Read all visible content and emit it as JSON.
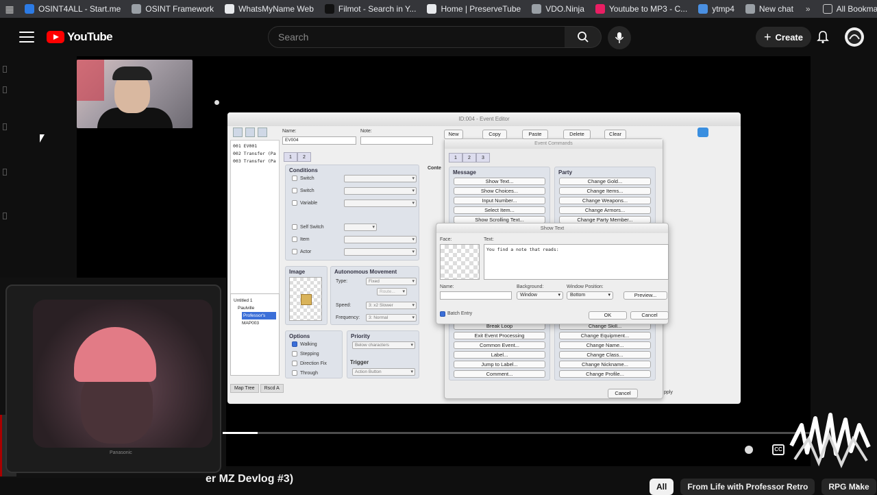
{
  "bookmarks": [
    {
      "label": "OSINT4ALL - Start.me",
      "color": "#2c7be5"
    },
    {
      "label": "OSINT Framework",
      "color": "#9aa0a6"
    },
    {
      "label": "WhatsMyName Web",
      "color": "#e8eaed"
    },
    {
      "label": "Filmot - Search in Y...",
      "color": "#111111"
    },
    {
      "label": "Home | PreserveTube",
      "color": "#e8eaed"
    },
    {
      "label": "VDO.Ninja",
      "color": "#9aa0a6"
    },
    {
      "label": "Youtube to MP3 - C...",
      "color": "#e91e63"
    },
    {
      "label": "ytmp4",
      "color": "#4a90e2"
    },
    {
      "label": "New chat",
      "color": "#9aa0a6"
    }
  ],
  "bookmarks_more": "»",
  "bookmarks_all": "All Bookmarks",
  "header": {
    "logo": "YouTube",
    "search_placeholder": "Search",
    "create_label": "Create"
  },
  "editor": {
    "title": "ID:004 - Event Editor",
    "name_label": "Name:",
    "name_value": "EV004",
    "note_label": "Note:",
    "top_buttons": [
      "New",
      "Copy",
      "Paste",
      "Delete",
      "Clear"
    ],
    "event_list": [
      "001 EV001",
      "002 Transfer (Pa",
      "003 Transfer (Pa"
    ],
    "map_tree": [
      "Untitled 1",
      "Paulville",
      "Professor's",
      "MAP003"
    ],
    "map_tabs": [
      "Map Tree",
      "Rscd A"
    ],
    "pages": [
      "1",
      "2"
    ],
    "conditions_title": "Conditions",
    "conditions": [
      "Switch",
      "Switch",
      "Variable",
      "Self Switch",
      "Item",
      "Actor"
    ],
    "contents_label": "Conte",
    "image_title": "Image",
    "auto_title": "Autonomous Movement",
    "type_label": "Type:",
    "type_value": "Fixed",
    "route_label": "Route...",
    "speed_label": "Speed:",
    "speed_value": "3: x2 Slower",
    "freq_label": "Frequency:",
    "freq_value": "3: Normal",
    "options_title": "Options",
    "options": [
      {
        "label": "Walking",
        "checked": true
      },
      {
        "label": "Stepping",
        "checked": false
      },
      {
        "label": "Direction Fix",
        "checked": false
      },
      {
        "label": "Through",
        "checked": false
      }
    ],
    "priority_title": "Priority",
    "priority_value": "Below characters",
    "trigger_title": "Trigger",
    "trigger_value": "Action Button",
    "cancel_label": "Cancel",
    "apply_label": "pply"
  },
  "commands": {
    "title": "Event Commands",
    "tabs": [
      "1",
      "2",
      "3"
    ],
    "message_title": "Message",
    "message": [
      "Show Text...",
      "Show Choices...",
      "Input Number...",
      "Select Item...",
      "Show Scrolling Text..."
    ],
    "party_title": "Party",
    "party": [
      "Change Gold...",
      "Change Items...",
      "Change Weapons...",
      "Change Armors...",
      "Change Party Member..."
    ],
    "flow_lower": [
      "Break Loop",
      "Exit Event Processing",
      "Common Event...",
      "Label...",
      "Jump to Label...",
      "Comment..."
    ],
    "actor_lower": [
      "Change Skill...",
      "Change Equipment...",
      "Change Name...",
      "Change Class...",
      "Change Nickname...",
      "Change Profile..."
    ],
    "cancel_label": "Cancel"
  },
  "show_text": {
    "title": "Show Text",
    "face_label": "Face:",
    "text_label": "Text:",
    "text_value": "You find a note that reads:",
    "name_label": "Name:",
    "background_label": "Background:",
    "background_value": "Window",
    "position_label": "Window Position:",
    "position_value": "Bottom",
    "preview_label": "Preview...",
    "batch_label": "Batch Entry",
    "ok_label": "OK",
    "cancel_label": "Cancel"
  },
  "player": {
    "progress": 0.06,
    "cc_label": "CC",
    "tv_brand": "Panasonic"
  },
  "video_title": "er MZ Devlog #3)",
  "chips": [
    "All",
    "From Life with Professor Retro",
    "RPG Make"
  ],
  "chips_arrow": "›"
}
